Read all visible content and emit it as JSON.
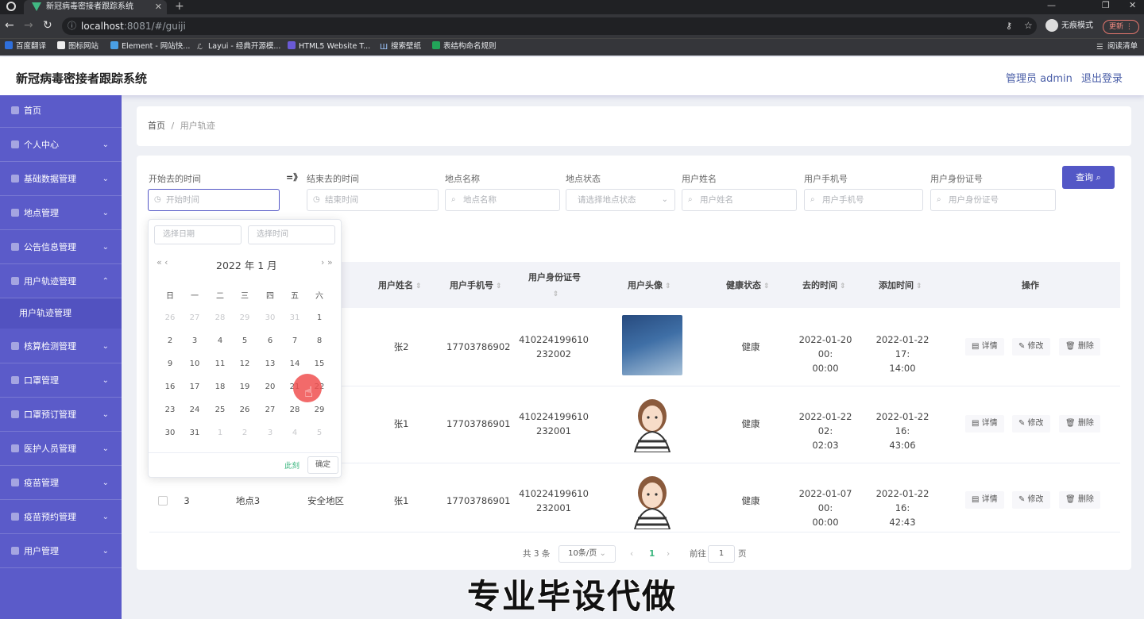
{
  "browser": {
    "tab_title": "新冠病毒密接者跟踪系统",
    "url_host": "localhost",
    "url_rest": ":8081/#/guiji",
    "incognito_label": "无痕模式",
    "update_label": "更新",
    "reading_list": "阅读清单",
    "bookmarks": [
      "百度翻译",
      "图标网站",
      "Element - 网站快...",
      "Layui - 经典开源模...",
      "HTML5 Website T...",
      "搜索壁纸",
      "表结构命名规则"
    ]
  },
  "header": {
    "title": "新冠病毒密接者跟踪系统",
    "user_label": "管理员 admin",
    "logout_label": "退出登录"
  },
  "sidebar": {
    "items": [
      {
        "label": "首页",
        "chevron": ""
      },
      {
        "label": "个人中心",
        "chevron": "⌄"
      },
      {
        "label": "基础数据管理",
        "chevron": "⌄"
      },
      {
        "label": "地点管理",
        "chevron": "⌄"
      },
      {
        "label": "公告信息管理",
        "chevron": "⌄"
      },
      {
        "label": "用户轨迹管理",
        "chevron": "⌃"
      },
      {
        "label": "核算检测管理",
        "chevron": "⌄"
      },
      {
        "label": "口罩管理",
        "chevron": "⌄"
      },
      {
        "label": "口罩预订管理",
        "chevron": "⌄"
      },
      {
        "label": "医护人员管理",
        "chevron": "⌄"
      },
      {
        "label": "疫苗管理",
        "chevron": "⌄"
      },
      {
        "label": "疫苗预约管理",
        "chevron": "⌄"
      },
      {
        "label": "用户管理",
        "chevron": "⌄"
      }
    ],
    "sub_item": "用户轨迹管理"
  },
  "breadcrumb": {
    "home": "首页",
    "sep": "/",
    "current": "用户轨迹"
  },
  "filters": {
    "labels": [
      "开始去的时间",
      "结束去的时间",
      "地点名称",
      "地点状态",
      "用户姓名",
      "用户手机号",
      "用户身份证号"
    ],
    "placeholders": [
      "开始时间",
      "结束时间",
      "地点名称",
      "请选择地点状态",
      "用户姓名",
      "用户手机号",
      "用户身份证号"
    ],
    "arrow": "=》",
    "query_button": "查询 ⌕"
  },
  "table": {
    "headers": [
      "用户姓名",
      "用户手机号",
      "用户身份证号",
      "用户头像",
      "健康状态",
      "去的时间",
      "添加时间",
      "操作"
    ],
    "rows": [
      {
        "name": "张2",
        "phone": "17703786902",
        "id1": "410224199610",
        "id2": "232002",
        "health": "健康",
        "go1": "2022-01-20 00:",
        "go2": "00:00",
        "add1": "2022-01-22 17:",
        "add2": "14:00"
      },
      {
        "name": "张1",
        "phone": "17703786901",
        "id1": "410224199610",
        "id2": "232001",
        "health": "健康",
        "go1": "2022-01-22 02:",
        "go2": "02:03",
        "add1": "2022-01-22 16:",
        "add2": "43:06"
      },
      {
        "index": "3",
        "place": "地点3",
        "place_status": "安全地区",
        "name": "张1",
        "phone": "17703786901",
        "id1": "410224199610",
        "id2": "232001",
        "health": "健康",
        "go1": "2022-01-07 00:",
        "go2": "00:00",
        "add1": "2022-01-22 16:",
        "add2": "42:43"
      }
    ],
    "ops": {
      "detail": "▤ 详情",
      "edit": "✎ 修改",
      "delete": "🗑 删除"
    }
  },
  "pagination": {
    "total": "共 3 条",
    "page_size": "10条/页",
    "current_page": "1",
    "goto_label": "前往",
    "goto_value": "1",
    "page_unit": "页"
  },
  "datepicker": {
    "date_placeholder": "选择日期",
    "time_placeholder": "选择时间",
    "title": "2022 年  1 月",
    "weekdays": [
      "日",
      "一",
      "二",
      "三",
      "四",
      "五",
      "六"
    ],
    "days": [
      [
        "26",
        "27",
        "28",
        "29",
        "30",
        "31",
        "1"
      ],
      [
        "2",
        "3",
        "4",
        "5",
        "6",
        "7",
        "8"
      ],
      [
        "9",
        "10",
        "11",
        "12",
        "13",
        "14",
        "15"
      ],
      [
        "16",
        "17",
        "18",
        "19",
        "20",
        "21",
        "22"
      ],
      [
        "23",
        "24",
        "25",
        "26",
        "27",
        "28",
        "29"
      ],
      [
        "30",
        "31",
        "1",
        "2",
        "3",
        "4",
        "5"
      ]
    ],
    "now_label": "此刻",
    "ok_label": "确定"
  },
  "watermark": "专业毕设代做",
  "colors": {
    "sidebar": "#5b5bc9",
    "accent": "#5357c6",
    "link": "#4b5fa8"
  }
}
